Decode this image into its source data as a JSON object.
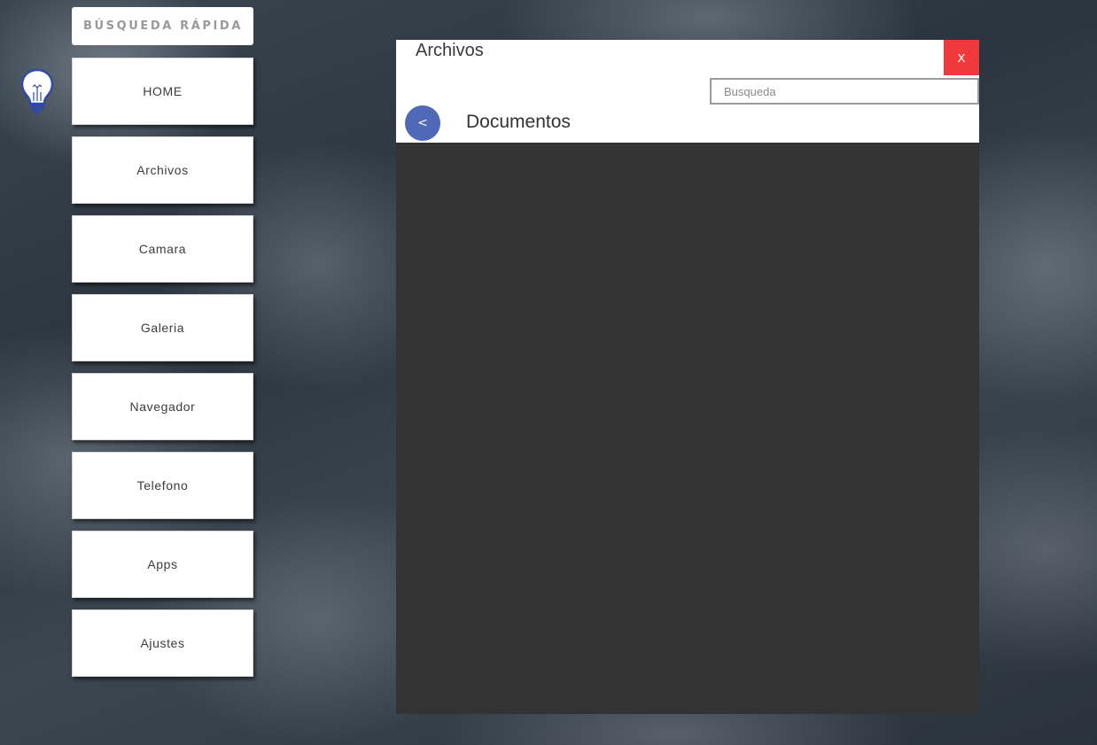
{
  "quick_search": {
    "label": "BÚSQUEDA RÁPIDA"
  },
  "icons": {
    "assistant": "lightbulb-icon"
  },
  "menu": {
    "items": [
      {
        "label": "HOME"
      },
      {
        "label": "Archivos"
      },
      {
        "label": "Camara"
      },
      {
        "label": "Galeria"
      },
      {
        "label": "Navegador"
      },
      {
        "label": "Telefono"
      },
      {
        "label": "Apps"
      },
      {
        "label": "Ajustes"
      }
    ]
  },
  "window": {
    "title": "Archivos",
    "close_label": "x",
    "search_placeholder": "Busqueda",
    "search_value": "",
    "back_label": "<",
    "folder_title": "Documentos"
  },
  "colors": {
    "close_button": "#f0393c",
    "back_button": "#5068b8",
    "window_body": "#333333",
    "bulb_outline": "#2f4aa8"
  }
}
